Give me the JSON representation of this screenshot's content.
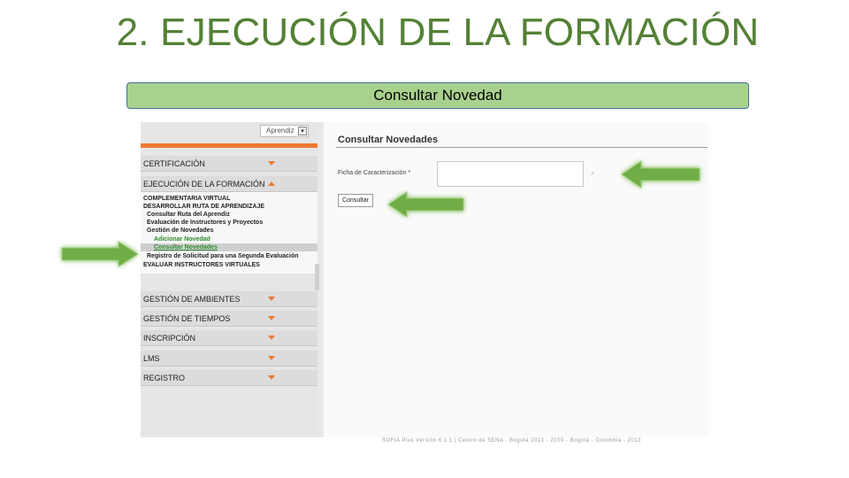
{
  "slide": {
    "title": "2. EJECUCIÓN DE LA FORMACIÓN",
    "subtitle": "Consultar Novedad"
  },
  "app": {
    "role_select": "Aprendiz",
    "menu": {
      "certificacion": "CERTIFICACIÓN",
      "ejecucion": "EJECUCIÓN DE LA FORMACIÓN",
      "gestion_ambientes": "GESTIÓN DE AMBIENTES",
      "gestion_tiempos": "GESTIÓN DE TIEMPOS",
      "inscripcion": "INSCRIPCIÓN",
      "lms": "LMS",
      "registro": "REGISTRO"
    },
    "submenu": {
      "complementaria": "COMPLEMENTARIA VIRTUAL",
      "desarrollar": "DESARROLLAR RUTA DE APRENDIZAJE",
      "consultar_ruta": "Consultar Ruta del Aprendiz",
      "evaluacion": "Evaluación de Instructores y Proyectos",
      "gestion_novedades": "Gestión de Novedades",
      "adicionar": "Adicionar Novedad",
      "consultar": "Consultar Novedades",
      "registro_solicitud": "Registro de Solicitud para una Segunda Evaluación",
      "evaluar": "EVALUAR INSTRUCTORES VIRTUALES"
    },
    "content": {
      "title": "Consultar Novedades",
      "field_label": "Ficha de Caracterización *",
      "field_value": "",
      "button": "Consultar"
    },
    "footer": "SOFIA Plus Versión 6.1.1 | Centro de SENA - Bogotá 2013 - 2100 - Bogotá - Colombia - 2013"
  },
  "colors": {
    "title": "#538135",
    "subtitle_bg": "#a9d18e",
    "accent_orange": "#ee7a2f",
    "arrow_green": "#70ad47"
  },
  "icons": {
    "dropdown": "chevron-down-icon",
    "field_lookup": "search-icon",
    "menu_collapse": "triangle-icon"
  }
}
